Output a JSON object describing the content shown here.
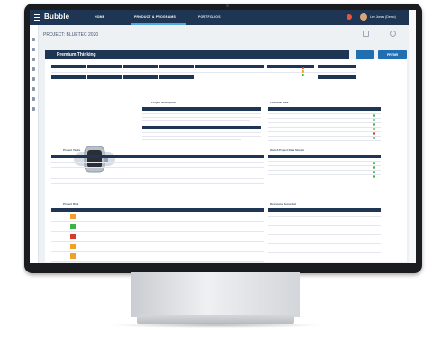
{
  "app": {
    "logo": "Bubble",
    "nav": [
      "HOME",
      "PRODUCT & PROGRAMS",
      "PORTFOLIOS"
    ],
    "user": "Lee Jones (Demo)"
  },
  "project": {
    "label": "PROJECT: BLUETEC 2020"
  },
  "card": {
    "title": "Premium Thinking",
    "button2": "PRTNR"
  },
  "sections": {
    "description": "Project Description",
    "key": "Financial Data",
    "issues": "Project Tasks",
    "risk": "Project Risk",
    "decisions": "Decisions Recorded",
    "summary": "Out of Project Data Stream"
  },
  "colors": {
    "navy": "#1e3553",
    "accent": "#1f6fb2",
    "green": "#3cb24a",
    "red": "#d93a2e",
    "orange": "#f0a12b"
  }
}
